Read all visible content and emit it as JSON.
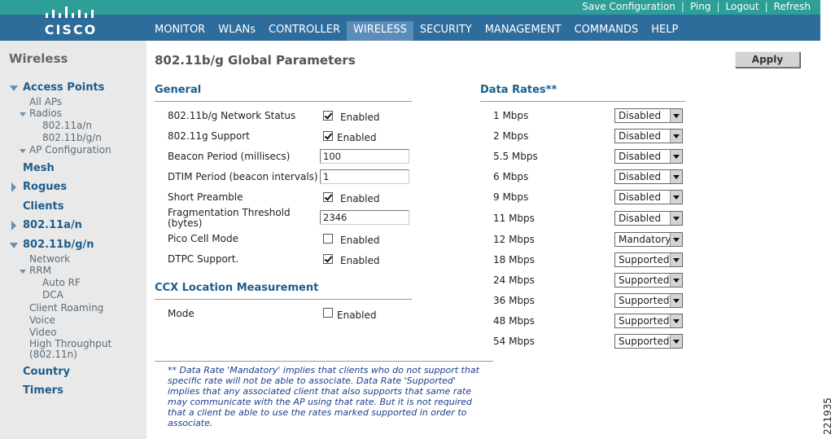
{
  "header": {
    "logo_text": "CISCO",
    "utility_links": [
      "Save Configuration",
      "Ping",
      "Logout",
      "Refresh"
    ],
    "nav": [
      "MONITOR",
      "WLANs",
      "CONTROLLER",
      "WIRELESS",
      "SECURITY",
      "MANAGEMENT",
      "COMMANDS",
      "HELP"
    ],
    "active_nav": "WIRELESS",
    "colors": {
      "top_bar": "#2e9e98",
      "nav_bar": "#2e6c9c",
      "active_tab": "#5b8db8"
    }
  },
  "sidebar": {
    "title": "Wireless",
    "access_points": "Access Points",
    "all_aps": "All APs",
    "radios": "Radios",
    "radio_a": "802.11a/n",
    "radio_bg": "802.11b/g/n",
    "ap_configuration": "AP Configuration",
    "mesh": "Mesh",
    "rogues": "Rogues",
    "clients": "Clients",
    "band_a": "802.11a/n",
    "band_bg": "802.11b/g/n",
    "network": "Network",
    "rrm": "RRM",
    "auto_rf": "Auto RF",
    "dca": "DCA",
    "client_roaming": "Client Roaming",
    "voice": "Voice",
    "video": "Video",
    "high_throughput_1": "High Throughput",
    "high_throughput_2": "(802.11n)",
    "country": "Country",
    "timers": "Timers"
  },
  "main": {
    "title": "802.11b/g Global Parameters",
    "apply_label": "Apply",
    "general": {
      "title": "General",
      "enabled_label": "Enabled",
      "network_status": {
        "label": "802.11b/g Network Status",
        "checked": true
      },
      "g_support": {
        "label": "802.11g Support",
        "checked": true
      },
      "beacon_period": {
        "label": "Beacon Period (millisecs)",
        "value": "100"
      },
      "dtim_period": {
        "label": "DTIM Period (beacon intervals)",
        "value": "1"
      },
      "short_preamble": {
        "label": "Short Preamble",
        "checked": true
      },
      "frag_threshold": {
        "label_1": "Fragmentation Threshold",
        "label_2": "(bytes)",
        "value": "2346"
      },
      "pico_cell": {
        "label": "Pico Cell Mode",
        "checked": false
      },
      "dtpc": {
        "label": "DTPC Support.",
        "checked": true
      }
    },
    "ccx": {
      "title": "CCX Location Measurement",
      "mode": {
        "label": "Mode",
        "checked": false
      }
    },
    "data_rates": {
      "title": "Data Rates",
      "title_marker": "**",
      "rates": [
        {
          "rate": "1 Mbps",
          "value": "Disabled"
        },
        {
          "rate": "2 Mbps",
          "value": "Disabled"
        },
        {
          "rate": "5.5 Mbps",
          "value": "Disabled"
        },
        {
          "rate": "6 Mbps",
          "value": "Disabled"
        },
        {
          "rate": "9 Mbps",
          "value": "Disabled"
        },
        {
          "rate": "11 Mbps",
          "value": "Disabled"
        },
        {
          "rate": "12 Mbps",
          "value": "Mandatory"
        },
        {
          "rate": "18 Mbps",
          "value": "Supported"
        },
        {
          "rate": "24 Mbps",
          "value": "Supported"
        },
        {
          "rate": "36 Mbps",
          "value": "Supported"
        },
        {
          "rate": "48 Mbps",
          "value": "Supported"
        },
        {
          "rate": "54 Mbps",
          "value": "Supported"
        }
      ]
    },
    "footnote": {
      "line_1": "** Data Rate 'Mandatory' implies that clients who do not support that",
      "line_2": "specific rate will not be able to associate. Data Rate 'Supported'",
      "line_3": "implies that any associated client that also supports that same rate",
      "line_4": "may communicate with the AP using that rate. But it is not required",
      "line_5": "that a client be able to use the rates marked supported in order to",
      "line_6": "associate."
    }
  },
  "figure_number": "221935"
}
